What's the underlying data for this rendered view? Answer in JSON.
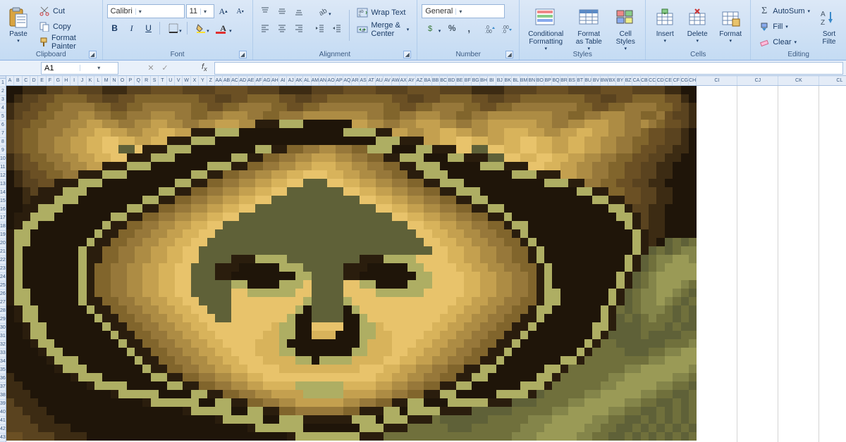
{
  "clipboard": {
    "paste": "Paste",
    "cut": "Cut",
    "copy": "Copy",
    "format_painter": "Format Painter",
    "label": "Clipboard"
  },
  "font": {
    "name": "Calibri",
    "size": "11",
    "label": "Font"
  },
  "alignment": {
    "wrap": "Wrap Text",
    "merge": "Merge & Center",
    "label": "Alignment"
  },
  "number": {
    "format": "General",
    "label": "Number"
  },
  "styles": {
    "conditional": "Conditional\nFormatting",
    "format_table": "Format\nas Table",
    "cell_styles": "Cell\nStyles",
    "label": "Styles"
  },
  "cells": {
    "insert": "Insert",
    "delete": "Delete",
    "format": "Format",
    "label": "Cells"
  },
  "editing": {
    "autosum": "AutoSum",
    "fill": "Fill",
    "clear": "Clear",
    "sort": "Sort\nFilte",
    "label": "Editing"
  },
  "namebox": "A1",
  "pixelart_palette": [
    "#1f1509",
    "#3c2b13",
    "#5a431f",
    "#6b5024",
    "#81652c",
    "#97783a",
    "#ad8c44",
    "#c4a04f",
    "#d8b35b",
    "#e8c36b",
    "#5f6138",
    "#70703c",
    "#84854a",
    "#9a9a56",
    "#aeae63",
    "#2a1d0d"
  ],
  "pixelart_rows": [
    "aabbbccddcccbbbcccddddccccddddccccbbbbccccddddccccddddccccbbbbccccddddccccddddccccbbaa",
    "abccddeeeeddccddeeeeeeeeddccddeeeeddccddeeeeeeeeddccddeeeeddccddeeeeeeeeddccddeeeeddba",
    "bccddeeffffeeddeeffffffeeddeeffffeeddeeffffffffeeddeeffffeeddeeffffffffeeddeeffffeedcb",
    "bcddeefffggffeefffgggffeeffgggffeefffggggggggffeeffgggffeeffggggggggffeeffgggffeefdccb",
    "cddeefffgghhggffgghhggffgghhhggpppoooaaaaaahhggffgghhhggffgghhhhhhggffgghhhggffgfeddcb",
    "cdeefffgghhiihhgghhiihhpppoooaaaaaaaaaaaaaoooopphhgghhiihhgghhiiihhgghhiihhggffeddccba",
    "cdeeffgghhiijjiihhiipppoooaaaaaaaaaaaaaaaaaaaaoooppphhiijjiihhiijjiihhiihhggffeeddccba",
    "cdeeffgghhiijjkkjpppoooaaaaaaaaooppeeffggffeeoooaaaoopppjjkkjjiijjiihhiihhggffeddccbba",
    "bcdeeffgghhiijjpppoooaaaaaaaooppeeffgghhhggffeeppoooaaaoopppkkjjiijjiihhggffeeddccbbaa",
    "bcddeeffgghhpppoooaaaaaaaoooppeeffgghhiiihhggffeeppoooaaaaaooopppjjiihhggffeeddccbbaaa",
    "abcddeeffpppoooaaaaaaaaooppeeffgghhiijjjiihhggffeeppoooaaaaaaaaoooppphhggffeeddccbbaaa",
    "abccddpppoooaaaaaaaaaooppeeffgghhiijjkkkjjiihhggffeeppoooaaaaaaaaaaoooppffeeddccbbaaaa",
    "aabcpppoooaaaaaaaaaooppeeffgghhiijjkkkkkkkjjiihhggffeeppoooaaaaaaaaaaaaooppeeddccbbaaa",
    "aabpppoooaaaaaaaaooppeeffgghhiijjkkkkkkkkkkkjjiihhggffeeppooaaaaaaaaaaaaaooppddccbbaaa",
    "aappoooaaaaaaaaooppeeffgghhiijjkkkkkkkkkkkkkkkjjiihhggffeeppooaaaaaaaaaaaaaoopccbbaaaa",
    "appoooaaaaaaaooppeeffgghhiijjkkkkkkkkkkkkkkkkkkkjjiihhggffeeppoaaaaaaaaaaaaaoopcbbaaaa",
    "apooaaaaaaaaoppeeffgghhiijjkkkkkkkkkkkkkkkkkkkkkkkjjiihhggffeepooaaaaaaaaaaaaopcbbaaaa",
    "pooaaaaaaaaoppeeffgghhiijjkkkkkkkkkkkkkkkkkkkkkkkkkjjiihhggffeepoaaaaaaaaaaaaaopbbaaaa",
    "pooaaaaaaaoppeeffgghhiijjkkkkkkkkkkkkkkkkkkkkkkkkkkkjjiihhggffeepoaaaaaaaaaaaaopbaklkl",
    "poaaaaaaaoppeeffgghhiijjkkkkkkkkkkkkkkkkkkkkkkkkkkkkkjjiihhggffeepoaaaaaaaaaaaopklklmm",
    "poaaaaaaaoppeeffgghhiijjkkkkpppooookkkkkkkkkpppoooojjjjiihhggffeepoaaaaaaaaaaopklmmnnm",
    "poaaaaaaaopeeffgghhiijjkkkpppaaaaaoookkkkkpppaaaaaoojjjjiihhggffeepoaaaaaaaaaopklmnnnn",
    "poaaaaaaaopeeffgghhiijjkkkppaaaaaaaaookkkkppaaaaaaaoojjjjiihhggffepoaaaaaaaaopklmnnnnn",
    "poaaaaaaaopeeffgghhiijjkkkkkooaaaaooojkkkkjjooaaaaooojjjjiihhggffepoaaaaaaaaopklmnnnml",
    "pooaaaaaaopeeffgghhiijjkkkkkjjoooooojjkkkkjjjjoooooojjjjjiihhggffepooaaaaaaopklmmnnmlk",
    "pooaaaaaaoppeeffgghhiijjkkkkjjjjjjjjjokkkkojjjjjjjjjjjjjiihhggffeepooaaaaaaopklmmnmlkl",
    "apooaaaaaaoppeeffgghhiijjkkkjjjjjjjjoakkkkaojjjjjjjjjjjiihhggffeepooaaaaaaoplklmmmlklk",
    "apooaaaaaaaoppeeffgghhiijjkkjjjjjjjoaakkkkaaojjjjjjjjjiihhggffeeppoaaaaaaaopklklmllklk",
    "aapooaaaaaaaoppeeffgghhiijjjjjjjjiooaajjjjaaooijjjjjjiihhggffeeppoaaaaaaaoopkkklllklkk",
    "aapooaaaaaaaaoppeeffgghhiijjjjjjiiooaaiiiaaaooiijjjjiihhggffeeppoaaaaaaaaopkkkklkkkkll",
    "aaapooaaaaaaaaoppeeffgghhiijjjjiiioaaaaaaaaaoiiijjjiihhggffeeppoaaaaaaaaopllkkkkkklllm",
    "aaaapooaaaaaaaaoppeeffgghhiijjjiiiooaaaaaaaooiiijjiihhggffeeppoaaaaaaaaopllllkkkllmmnn",
    "aaaaapoooaaaaaaaoppeeffgghhiijjjiiiiooaooooiiiijjiihhggffeeppoaaaaaaaoopllllllllmmnnnn",
    "aaaaaapoooaaaaaaaoppeeffgghhiijjjjiiiiiiiiiijjjiihhggffeeppooaaaaaaooplllllllmmnnnnnnm",
    "baaaaaaapoooaaaaaaooppeeffgghhiijjjjjjjjjjjjjjiihhggffeeppooaaaaaaoopllllllmmnnnnnnmml",
    "bbaaaaaaaapooooaaaaaooppeeffgghhiiiiooooooiiiihhggffeeppooaaaaaaooopllllllmmnnnnnmmllk",
    "bbbaaaaaaaaaapoooooaaaaooppeeffgghhhhooooohhhhggffeeppooaaaaaoooopklllllmmnnnnnmmllkkl",
    "cbbbaaaaaaaaaaaaapooooooaaooppeeffgghhhhhhggffeeppooaaaooooopppkkkllllmmnnnnnmmllkklkl",
    "ccbbbaaaaaaaaaaaaaaaaapoooooaaooppeeffffffeepppooaooooppppkkkkklllllmmnnnnnmmllkklklkl",
    "cccbbbaaaaaaaaaaaaaaaaaaaapoooooaaoooppppppoooaoooppplkkkkkklllllmmmnnnnnmmllkklklklkl",
    "ccccbbbbaaaaaaaaaaaaaaaaaaaaaapooooooaaaaaaaoooppplllllkkkllllllmmmnnnnnmmllkklklklklk",
    "ddccccbbbbaaaaaaaaaaaaaaaaaaaaaaaaapoooooooopppllllllllllllllllmmmnnnnnmmllkklklklklkl"
  ]
}
